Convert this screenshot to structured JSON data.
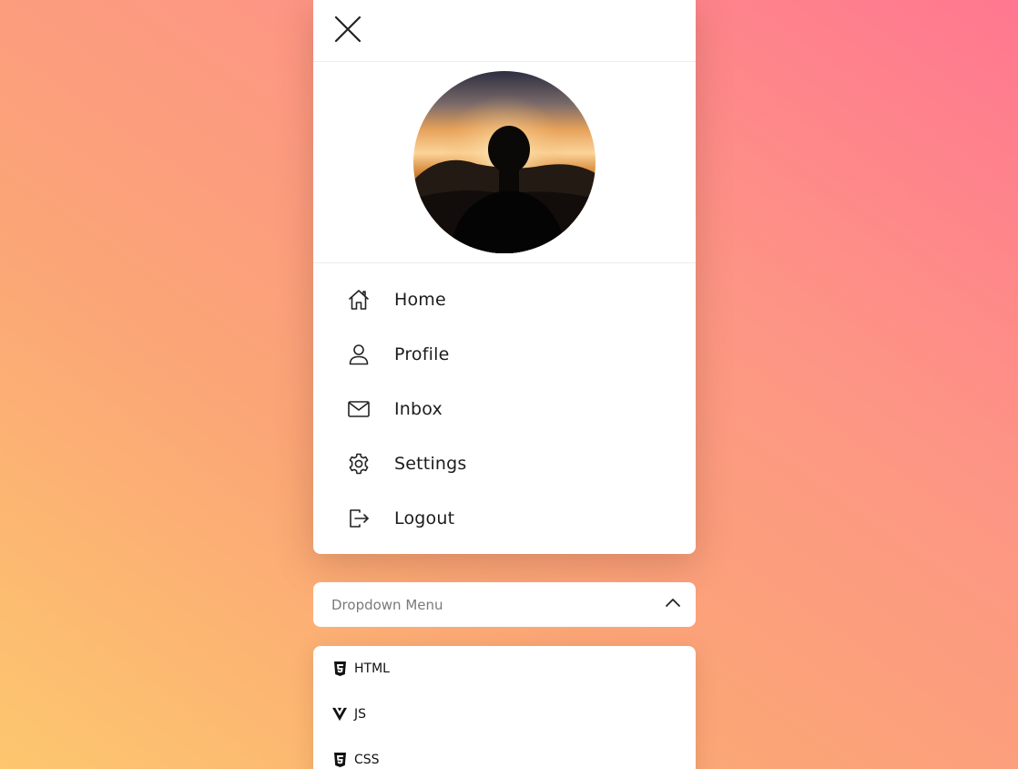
{
  "panel": {
    "close_icon": "close-icon",
    "avatar_alt": "",
    "menu": [
      {
        "label": "Home",
        "icon": "home-icon"
      },
      {
        "label": "Profile",
        "icon": "user-icon"
      },
      {
        "label": "Inbox",
        "icon": "mail-icon"
      },
      {
        "label": "Settings",
        "icon": "gear-icon"
      },
      {
        "label": "Logout",
        "icon": "logout-icon"
      }
    ]
  },
  "dropdown": {
    "label": "Dropdown Menu",
    "icon": "chevron-up-icon",
    "items": [
      {
        "label": "HTML",
        "icon": "html5-icon"
      },
      {
        "label": "JS",
        "icon": "vue-icon"
      },
      {
        "label": "CSS",
        "icon": "css3-icon"
      }
    ]
  },
  "colors": {
    "background_start": "#fdc76e",
    "background_end": "#ff7790",
    "panel": "#ffffff",
    "text": "#1c1c1c",
    "muted_text": "#7a7a7a"
  }
}
